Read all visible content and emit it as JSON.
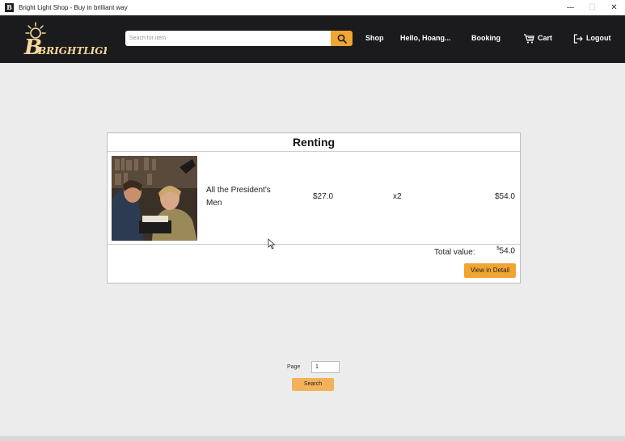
{
  "window": {
    "title": "Bright Light Shop - Buy in brilliant way",
    "icon_glyph": "B",
    "controls": {
      "minimize": "—",
      "maximize": "☐",
      "close": "✕"
    }
  },
  "header": {
    "logo_text": "BRIGHTLIGHT",
    "search": {
      "placeholder": "Seach for item",
      "value": "",
      "icon": "search-icon"
    },
    "nav": {
      "shop": "Shop",
      "greeting": "Hello, Hoang...",
      "booking": "Booking",
      "cart": "Cart",
      "logout": "Logout"
    },
    "colors": {
      "bar": "#1b1b1d",
      "accent": "#f0a431"
    }
  },
  "renting": {
    "title": "Renting",
    "items": [
      {
        "name": "All the President's Men",
        "price": "$27.0",
        "quantity": "x2",
        "subtotal": "$54.0"
      }
    ],
    "total_label": "Total value:",
    "total_currency": "$",
    "total_amount": "54.0",
    "view_detail_label": "View in Detail"
  },
  "pagination": {
    "page_label": "Page",
    "page_value": "1",
    "search_label": "Search"
  }
}
